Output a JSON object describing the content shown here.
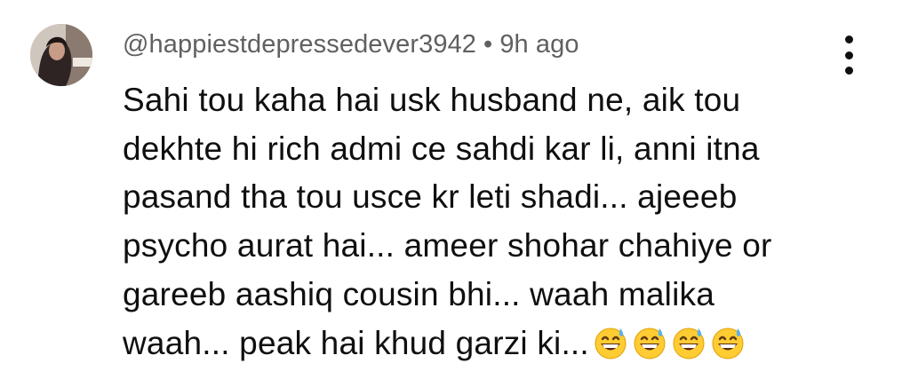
{
  "comment": {
    "author": "@happiestdepressedever3942",
    "separator": "•",
    "time": "9h ago",
    "lines": [
      "Sahi tou kaha hai usk husband ne, aik tou",
      "dekhte hi rich admi ce sahdi kar li, anni itna",
      "pasand tha tou usce kr leti shadi... ajeeeb",
      "psycho aurat hai... ameer shohar chahiye or",
      "gareeb aashiq cousin bhi... waah malika",
      "waah... peak hai khud garzi ki..."
    ],
    "emojis": [
      "grinning-sweat-emoji",
      "grinning-sweat-emoji",
      "grinning-sweat-emoji",
      "grinning-sweat-emoji"
    ],
    "more_icon": "more-vertical-icon",
    "avatar_icon": "user-avatar"
  },
  "colors": {
    "meta_text": "#606060",
    "body_text": "#0f0f0f",
    "background": "#ffffff",
    "emoji_face": "#ffcc33",
    "emoji_sweat": "#5ab0e6"
  }
}
